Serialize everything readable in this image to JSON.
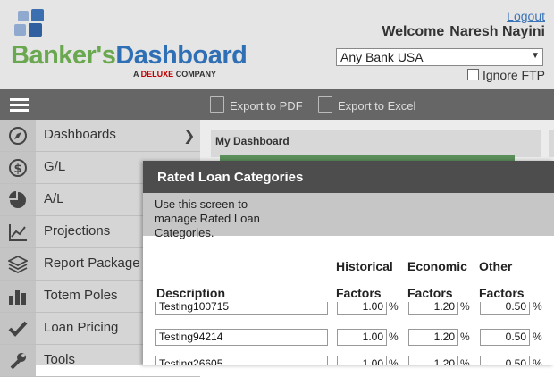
{
  "header": {
    "brand_part1": "Banker's",
    "brand_part2": "Dashboard",
    "tagline_prefix": "A ",
    "tagline_brand": "DELUXE",
    "tagline_suffix": " COMPANY",
    "logout": "Logout",
    "welcome": "Welcome",
    "user_name": "Naresh Nayini",
    "bank_select_value": "Any Bank USA",
    "ignore_ftp_label": "Ignore FTP"
  },
  "toolbar": {
    "export_pdf": "Export to PDF",
    "export_excel": "Export to Excel"
  },
  "sidebar": {
    "items": [
      {
        "label": "Dashboards",
        "icon": "compass-icon"
      },
      {
        "label": "G/L",
        "icon": "dollar-icon"
      },
      {
        "label": "A/L",
        "icon": "pie-chart-icon"
      },
      {
        "label": "Projections",
        "icon": "line-chart-icon"
      },
      {
        "label": "Report Package",
        "icon": "layers-icon"
      },
      {
        "label": "Totem Poles",
        "icon": "bar-chart-icon"
      },
      {
        "label": "Loan Pricing",
        "icon": "checkmark-icon"
      },
      {
        "label": "Tools",
        "icon": "wrench-icon"
      }
    ]
  },
  "main": {
    "dashboard_title": "My Dashboard"
  },
  "modal": {
    "title": "Rated Loan Categories",
    "description": "Use this screen to manage Rated Loan Categories.",
    "columns": {
      "description": "Description",
      "historical_line1": "Historical",
      "historical_line2": "Factors",
      "economic_line1": "Economic",
      "economic_line2": "Factors",
      "other_line1": "Other",
      "other_line2": "Factors"
    },
    "percent_sign": "%",
    "rows": [
      {
        "description": "Testing100715",
        "historical": "1.00",
        "economic": "1.20",
        "other": "0.50"
      },
      {
        "description": "Testing94214",
        "historical": "1.00",
        "economic": "1.20",
        "other": "0.50"
      },
      {
        "description": "Testing26605",
        "historical": "1.00",
        "economic": "1.20",
        "other": "0.50"
      }
    ]
  },
  "colors": {
    "brand_green": "#6aa84f",
    "brand_blue": "#2f6fb5",
    "toolbar_bg": "#666666",
    "modal_header_bg": "#4d4d4d",
    "sidebar_bg": "#d5d5d5"
  }
}
